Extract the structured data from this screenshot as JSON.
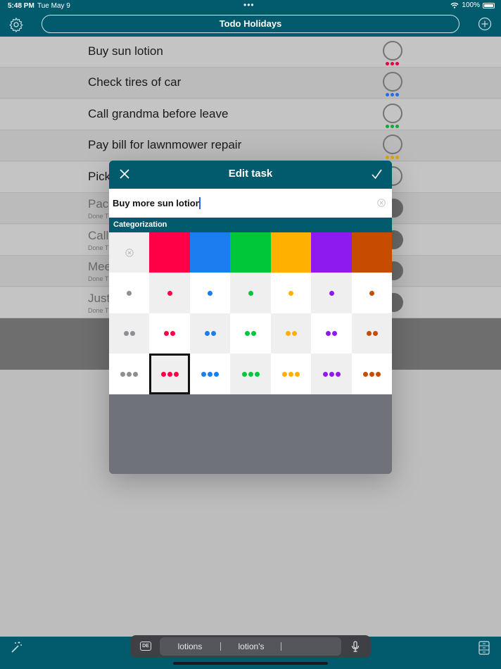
{
  "status": {
    "time": "5:48 PM",
    "date": "Tue May 9",
    "battery": "100%"
  },
  "nav": {
    "title": "Todo Holidays"
  },
  "tasks": [
    {
      "title": "Buy sun lotion",
      "color": "#e3003f",
      "done": false
    },
    {
      "title": "Check tires of car",
      "color": "#1e70e8",
      "done": false
    },
    {
      "title": "Call grandma before leave",
      "color": "#10a83a",
      "done": false
    },
    {
      "title": "Pay bill for lawnmower repair",
      "color": "#e3a200",
      "done": false
    },
    {
      "title": "Pick",
      "color": "#e3a200",
      "done": false
    },
    {
      "title": "Pacl",
      "sub": "Done T",
      "done": true
    },
    {
      "title": "Call",
      "sub": "Done T",
      "done": true
    },
    {
      "title": "Mee",
      "sub": "Done T",
      "done": true
    },
    {
      "title": "Just",
      "sub": "Done T",
      "done": true
    }
  ],
  "modal": {
    "title": "Edit task",
    "task_value": "Buy more sun lotion",
    "section": "Categorization",
    "colors": [
      "#8e8e93",
      "#ff0046",
      "#1a7df0",
      "#00c63a",
      "#ffb000",
      "#8e1af0",
      "#c84c00"
    ],
    "selected": {
      "row": 3,
      "col": 1
    }
  },
  "keyboard": {
    "lang": "DE",
    "suggestions": [
      "lotions",
      "lotion's",
      ""
    ]
  }
}
